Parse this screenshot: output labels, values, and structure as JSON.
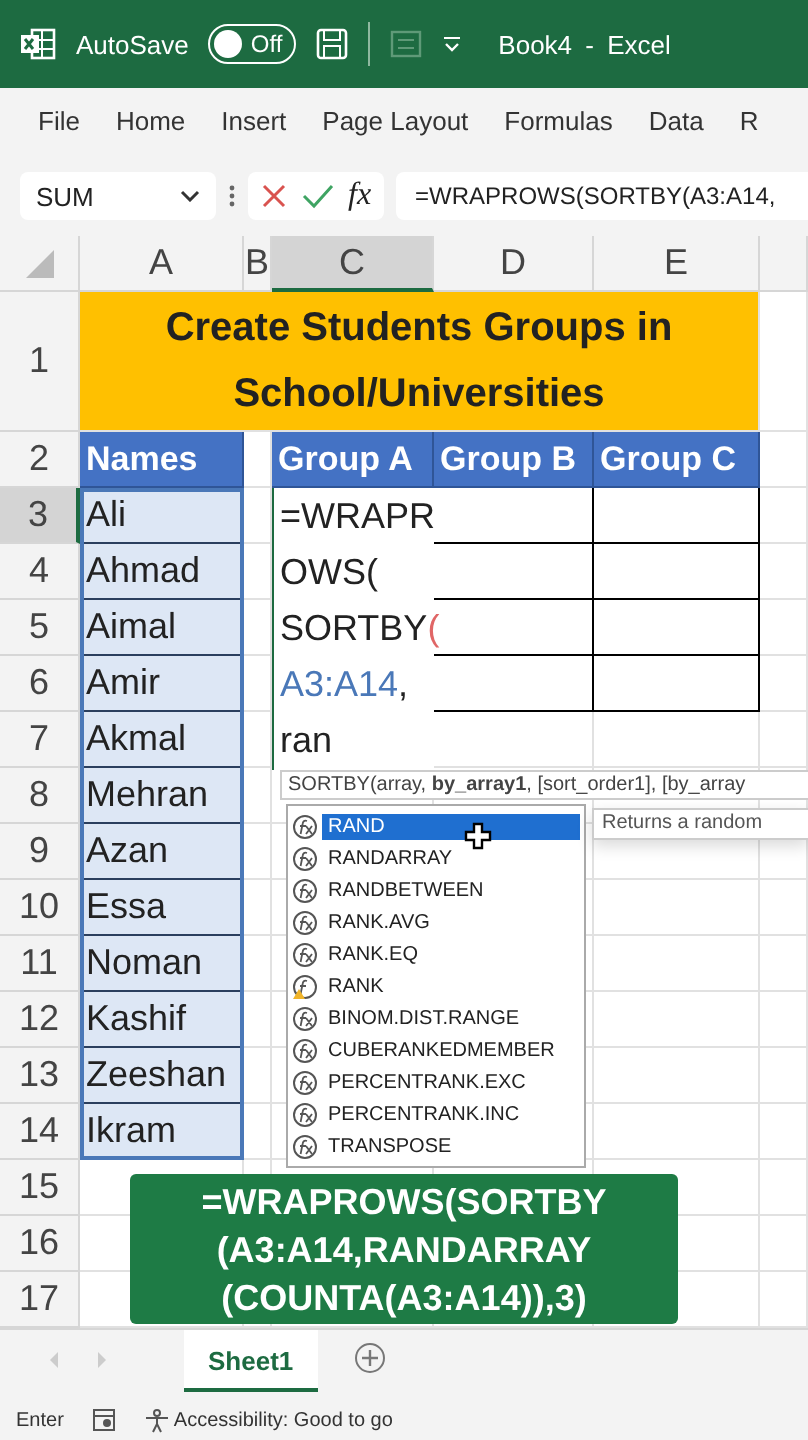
{
  "title_bar": {
    "autosave_label": "AutoSave",
    "autosave_toggle": {
      "on": false,
      "label": "Off"
    },
    "title": "Book4 - Excel"
  },
  "ribbon_tabs": [
    {
      "label": "File",
      "selected": false
    },
    {
      "label": "Home",
      "selected": false
    },
    {
      "label": "Insert",
      "selected": false
    },
    {
      "label": "Page Layout",
      "selected": false
    },
    {
      "label": "Formulas",
      "selected": false
    },
    {
      "label": "Data",
      "selected": false
    },
    {
      "label": "R",
      "selected": false
    }
  ],
  "formula_bar": {
    "name_box": "SUM",
    "function_symbol": "fx",
    "formula": "=WRAPROWS(SORTBY(A3:A14,"
  },
  "columns": [
    {
      "label": "A",
      "selected": false
    },
    {
      "label": "B",
      "selected": false
    },
    {
      "label": "C",
      "selected": true
    },
    {
      "label": "D",
      "selected": false
    },
    {
      "label": "E",
      "selected": false
    }
  ],
  "rows": [
    {
      "label": "1",
      "selected": false
    },
    {
      "label": "2",
      "selected": false
    },
    {
      "label": "3",
      "selected": true
    },
    {
      "label": "4",
      "selected": false
    },
    {
      "label": "5",
      "selected": false
    },
    {
      "label": "6",
      "selected": false
    },
    {
      "label": "7",
      "selected": false
    },
    {
      "label": "8",
      "selected": false
    },
    {
      "label": "9",
      "selected": false
    },
    {
      "label": "10",
      "selected": false
    },
    {
      "label": "11",
      "selected": false
    },
    {
      "label": "12",
      "selected": false
    },
    {
      "label": "13",
      "selected": false
    },
    {
      "label": "14",
      "selected": false
    },
    {
      "label": "15",
      "selected": false
    },
    {
      "label": "16",
      "selected": false
    },
    {
      "label": "17",
      "selected": false
    }
  ],
  "title_cell": [
    "Create Students Groups in",
    "School/Universities"
  ],
  "names_header": "Names",
  "group_headers": [
    "Group A",
    "Group B",
    "Group C"
  ],
  "names": [
    "Ali",
    "Ahmad",
    "Aimal",
    "Amir",
    "Akmal",
    "Mehran",
    "Azan",
    "Essa",
    "Noman",
    "Kashif",
    "Zeeshan",
    "Ikram"
  ],
  "cell_editor": [
    [
      {
        "text": "=WRAPR"
      }
    ],
    [
      {
        "text": "OWS("
      }
    ],
    [
      {
        "text": "SORTBY"
      },
      {
        "text": "(",
        "color": "#e06666"
      }
    ],
    [
      {
        "text": "A3:A14",
        "color": "#4a78b8"
      },
      {
        "text": ","
      }
    ],
    [
      {
        "text": "ran"
      }
    ]
  ],
  "signature_tip": "SORTBY(array, **by_array1**, [sort_order1], [by_array",
  "autocomplete": [
    {
      "label": "RAND",
      "kind": "function",
      "selected": true
    },
    {
      "label": "RANDARRAY",
      "kind": "function",
      "selected": false
    },
    {
      "label": "RANDBETWEEN",
      "kind": "function",
      "selected": false
    },
    {
      "label": "RANK.AVG",
      "kind": "function",
      "selected": false
    },
    {
      "label": "RANK.EQ",
      "kind": "function",
      "selected": false
    },
    {
      "label": "RANK",
      "kind": "compatibility",
      "selected": false
    },
    {
      "label": "BINOM.DIST.RANGE",
      "kind": "function",
      "selected": false
    },
    {
      "label": "CUBERANKEDMEMBER",
      "kind": "function",
      "selected": false
    },
    {
      "label": "PERCENTRANK.EXC",
      "kind": "function",
      "selected": false
    },
    {
      "label": "PERCENTRANK.INC",
      "kind": "function",
      "selected": false
    },
    {
      "label": "TRANSPOSE",
      "kind": "function",
      "selected": false
    }
  ],
  "description_tip": "Returns a random",
  "callout": [
    "=WRAPROWS(SORTBY",
    "(A3:A14,RANDARRAY",
    "(COUNTA(A3:A14)),3)"
  ],
  "sheet_tabs": [
    {
      "label": "Sheet1",
      "selected": true
    }
  ],
  "status_bar": {
    "mode": "Enter",
    "accessibility": "Accessibility: Good to go"
  }
}
